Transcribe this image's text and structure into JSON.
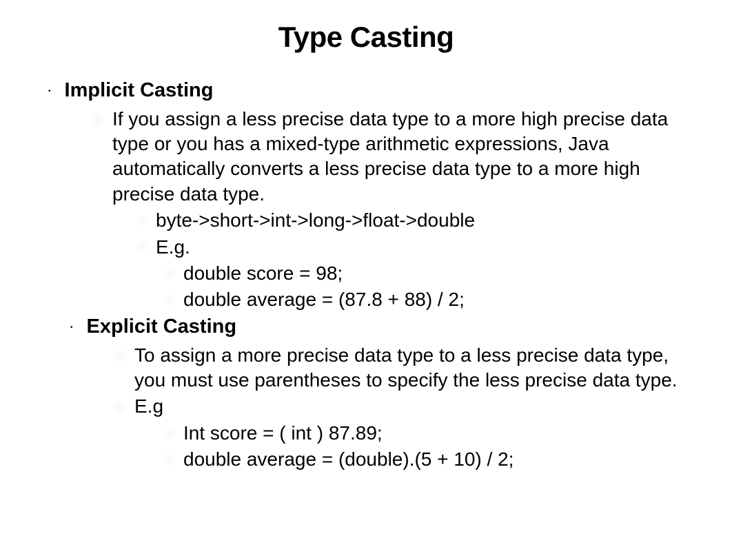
{
  "title": "Type Casting",
  "sections": [
    {
      "heading": "Implicit Casting",
      "body": "If you assign a less precise data type to a more high precise data type or you has a mixed-type arithmetic expressions, Java automatically converts a less precise data type to a more high precise data type.",
      "sub1": "byte->short->int->long->float->double",
      "sub2": "E.g.",
      "examples": [
        "double score = 98;",
        "double average = (87.8 + 88) / 2;"
      ]
    },
    {
      "heading": "Explicit Casting",
      "body": "To assign a more precise data type to a less precise data type, you must use parentheses to specify the less precise data type.",
      "sub2": "E.g",
      "examples": [
        "Int score = ( int ) 87.89;",
        "double average = (double).(5 + 10) / 2;"
      ]
    }
  ]
}
